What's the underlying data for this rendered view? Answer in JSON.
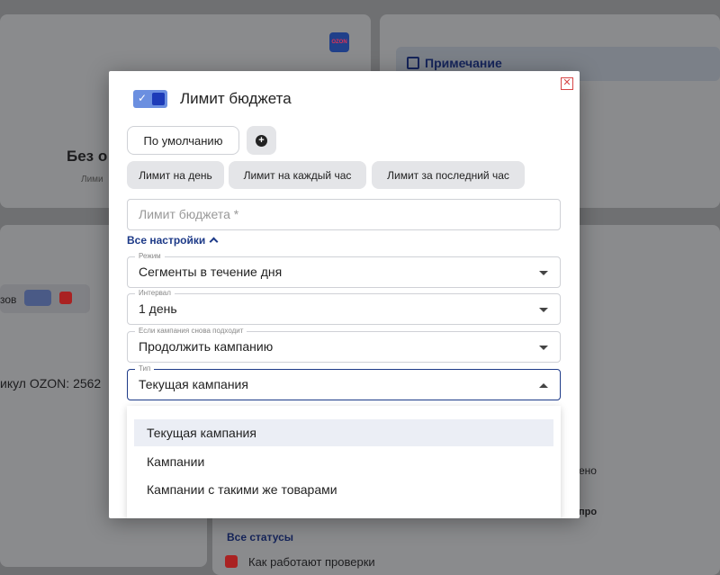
{
  "background": {
    "ozon_badge": "OZON",
    "note_label": "Примечание",
    "product_name_partial": "Без о",
    "limit_partial": "Лими",
    "orders_partial": "зов",
    "article_partial": "икул OZON: 2562",
    "statuses_label": "Все статусы",
    "checks_label": "Как работают проверки",
    "partial_right_1": "ено",
    "partial_right_2": "про"
  },
  "modal": {
    "title": "Лимит бюджета",
    "close_icon": "close-icon",
    "default_button": "По умолчанию",
    "add_icon": "plus-circle-icon",
    "limit_types": [
      "Лимит на день",
      "Лимит на каждый час",
      "Лимит за последний час"
    ],
    "budget_input_placeholder": "Лимит бюджета *",
    "all_settings_label": "Все настройки",
    "fields": {
      "mode": {
        "label": "Режим",
        "value": "Сегменты в течение дня"
      },
      "interval": {
        "label": "Интервал",
        "value": "1 день"
      },
      "on_match": {
        "label": "Если кампания снова подходит",
        "value": "Продолжить кампанию"
      },
      "type": {
        "label": "Тип",
        "value": "Текущая кампания"
      }
    },
    "type_options": [
      "Текущая кампания",
      "Кампании",
      "Кампании с такими же товарами"
    ]
  },
  "colors": {
    "accent": "#1d3a88",
    "toggle": "#6b8fe0",
    "close": "#d64545"
  }
}
